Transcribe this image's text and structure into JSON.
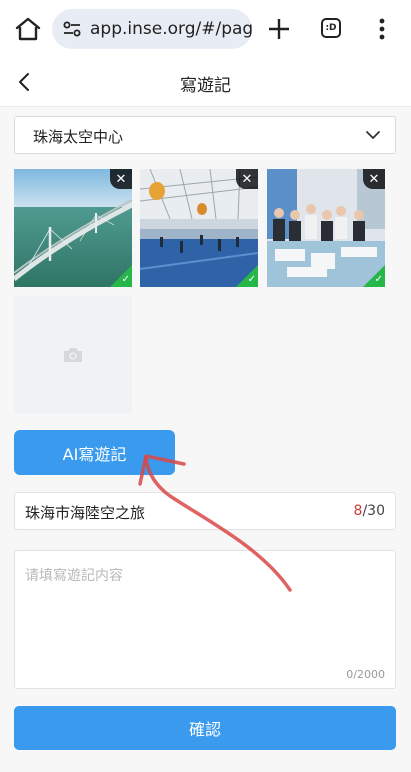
{
  "browser": {
    "url": "app.inse.org/#/pages",
    "tabs_label": ":D"
  },
  "header": {
    "title": "寫遊記"
  },
  "location_select": {
    "value": "珠海太空中心"
  },
  "photos": [
    {
      "alt": "sea bridge"
    },
    {
      "alt": "exhibition hall"
    },
    {
      "alt": "visitors at model"
    }
  ],
  "uploader": {
    "icon": "camera-icon"
  },
  "ai_button": {
    "label": "AI寫遊記"
  },
  "title_field": {
    "value": "珠海市海陸空之旅",
    "count": "8",
    "max": "/30"
  },
  "content_field": {
    "placeholder": "请填寫遊記内容",
    "counter": "0/2000"
  },
  "confirm_button": {
    "label": "確認"
  },
  "colors": {
    "primary": "#3a9aee",
    "counter_highlight": "#d03a3a",
    "annotation_arrow": "#d94848",
    "success": "#26b64a"
  }
}
